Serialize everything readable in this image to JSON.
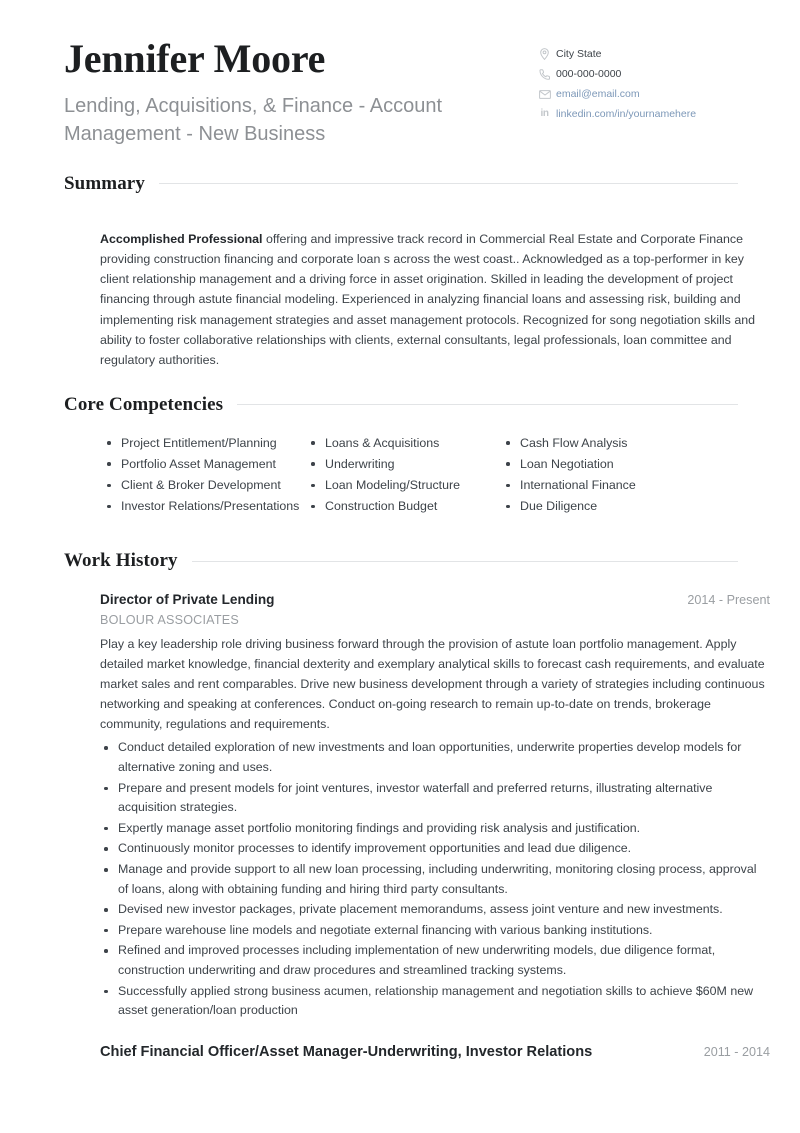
{
  "header": {
    "name": "Jennifer Moore",
    "headline": "Lending, Acquisitions, & Finance - Account Management - New Business",
    "contact": [
      {
        "icon": "location-pin-icon",
        "text": "City State",
        "style": "plain"
      },
      {
        "icon": "phone-icon",
        "text": "000-000-0000",
        "style": "plain"
      },
      {
        "icon": "envelope-icon",
        "text": "email@email.com",
        "style": "link"
      },
      {
        "icon": "linkedin-icon",
        "text": "linkedin.com/in/yournamehere",
        "style": "link"
      }
    ]
  },
  "colors": {
    "name": "#1d1f21",
    "headline": "#8d9094",
    "body": "#3d4349",
    "muted": "#9a9ea2",
    "link": "#7d98b8",
    "rule": "#e2e4e6",
    "icon": "#c3c7cb"
  },
  "summary": {
    "title": "Summary",
    "lead": "Accomplished Professional",
    "text": " offering and impressive track record in Commercial Real Estate and Corporate Finance providing construction financing and corporate loan s across the west coast.. Acknowledged as a top-performer in key client relationship management and a driving force in asset origination. Skilled in leading the development of project financing through astute financial modeling. Experienced in analyzing financial loans and assessing risk, building and implementing risk management strategies and asset management protocols. Recognized for song negotiation skills and ability to foster collaborative relationships with clients, external consultants, legal professionals, loan committee and regulatory authorities."
  },
  "competencies": {
    "title": "Core Competencies",
    "columns": [
      [
        "Project Entitlement/Planning",
        "Portfolio Asset Management",
        "Client & Broker Development",
        "Investor Relations/Presentations"
      ],
      [
        "Loans & Acquisitions",
        "Underwriting",
        "Loan Modeling/Structure",
        "Construction Budget"
      ],
      [
        "Cash Flow Analysis",
        "Loan Negotiation",
        "International Finance",
        "Due Diligence"
      ]
    ]
  },
  "work_history": {
    "title": "Work History",
    "jobs": [
      {
        "title": "Director of Private Lending",
        "dates": "2014 - Present",
        "company": "BOLOUR ASSOCIATES",
        "description": "Play a key leadership role driving business forward through the provision of astute loan portfolio management. Apply detailed market knowledge, financial dexterity and exemplary analytical skills to forecast cash requirements, and evaluate market sales and rent comparables. Drive new business development through a variety of strategies including continuous networking and speaking at conferences. Conduct on-going research to remain up-to-date on trends, brokerage community, regulations and requirements.",
        "bullets": [
          "Conduct detailed exploration of new investments and loan opportunities, underwrite properties develop models for alternative zoning and uses.",
          "Prepare and present models for joint ventures, investor waterfall and preferred returns, illustrating alternative acquisition strategies.",
          "Expertly manage asset portfolio monitoring findings and providing risk analysis and justification.",
          "Continuously monitor processes to identify improvement opportunities and lead due diligence.",
          "Manage and provide support to all new loan processing, including underwriting, monitoring closing process, approval of loans, along with obtaining funding and hiring third party consultants.",
          "Devised new investor packages, private placement memorandums, assess joint venture and new investments.",
          "Prepare warehouse line models and negotiate external financing with various banking institutions.",
          "Refined and improved processes including implementation of new underwriting models, due diligence format, construction underwriting and draw procedures and streamlined tracking systems.",
          "Successfully applied strong business acumen, relationship management and negotiation skills to achieve $60M new asset generation/loan production"
        ]
      },
      {
        "title": "Chief Financial Officer/Asset Manager-Underwriting, Investor Relations",
        "dates": "2011 - 2014",
        "company": "",
        "description": "",
        "bullets": []
      }
    ]
  }
}
